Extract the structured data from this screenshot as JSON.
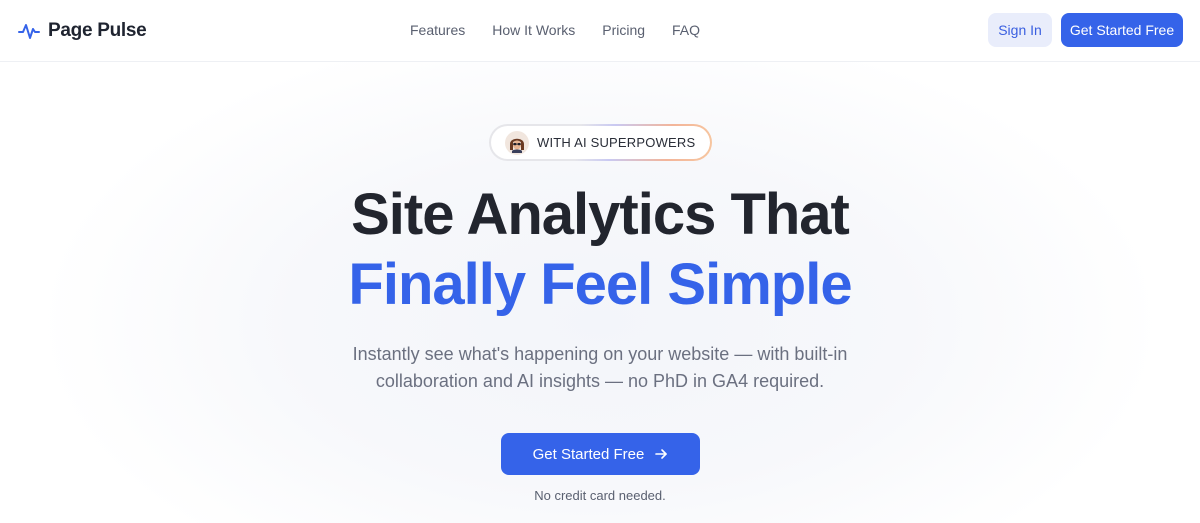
{
  "brand": {
    "name": "Page Pulse",
    "icon": "pulse-icon",
    "accent_color": "#3563e9"
  },
  "nav": {
    "links": [
      "Features",
      "How It Works",
      "Pricing",
      "FAQ"
    ],
    "sign_in": "Sign In",
    "cta": "Get Started Free"
  },
  "hero": {
    "badge": "WITH AI SUPERPOWERS",
    "badge_icon": "ai-avatar-icon",
    "headline_line1": "Site Analytics That",
    "headline_line2": "Finally Feel Simple",
    "subtext": "Instantly see what's happening on your website — with built-in collaboration and AI insights — no PhD in GA4 required.",
    "cta": "Get Started Free",
    "cta_icon": "arrow-right-icon",
    "note": "No credit card needed."
  }
}
